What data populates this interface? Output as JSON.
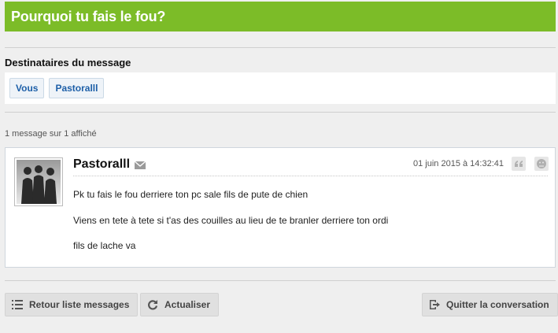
{
  "thread": {
    "title": "Pourquoi tu fais le fou?"
  },
  "recipients": {
    "heading": "Destinataires du message",
    "items": [
      {
        "label": "Vous"
      },
      {
        "label": "Pastoralll"
      }
    ]
  },
  "message_count": "1 message sur 1 affiché",
  "message": {
    "author": "Pastoralll",
    "date": "01 juin 2015 à 14:32:41",
    "body": [
      "Pk tu fais le fou derriere ton pc sale fils de pute de chien",
      "Viens en tete à tete si t'as des couilles au lieu de te branler derriere ton ordi",
      "fils de lache va"
    ],
    "icons": [
      "mail-icon",
      "quote-icon",
      "report-icon"
    ]
  },
  "actions": {
    "back_label": "Retour liste messages",
    "refresh_label": "Actualiser",
    "leave_label": "Quitter la conversation"
  },
  "colors": {
    "title_bar": "#7cbc28",
    "chip_text": "#1d5fa8"
  }
}
